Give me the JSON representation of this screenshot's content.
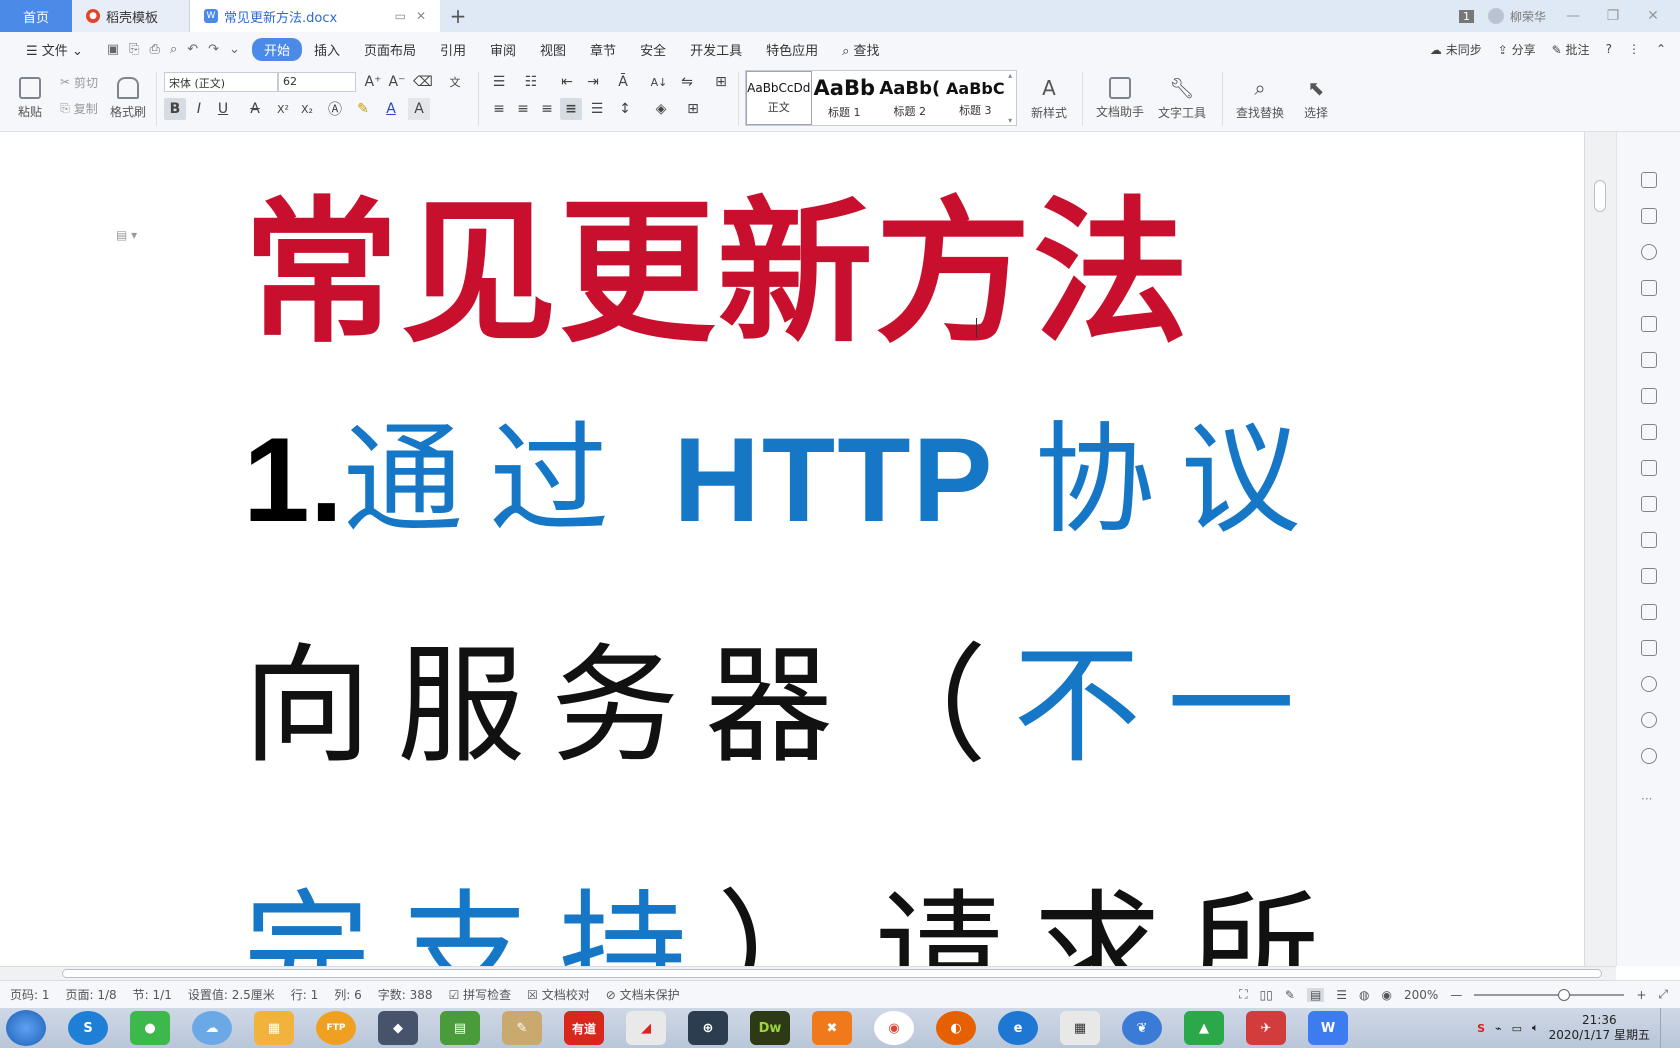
{
  "tabs": {
    "home": "首页",
    "template": "稻壳模板",
    "doc": "常见更新方法.docx",
    "badge": "1",
    "user": "柳荣华"
  },
  "menu": {
    "file": "文件",
    "items": [
      "开始",
      "插入",
      "页面布局",
      "引用",
      "审阅",
      "视图",
      "章节",
      "安全",
      "开发工具",
      "特色应用"
    ],
    "search": "查找",
    "sync": "未同步",
    "share": "分享",
    "comment": "批注"
  },
  "ribbon": {
    "paste": "粘贴",
    "cut": "剪切",
    "copy": "复制",
    "format_painter": "格式刷",
    "font_name": "宋体 (正文)",
    "font_size": "62",
    "bold": "B",
    "italic": "I",
    "underline": "U",
    "styles": [
      {
        "sample": "AaBbCcDd",
        "label": "正文"
      },
      {
        "sample": "AaBb",
        "label": "标题 1"
      },
      {
        "sample": "AaBb(",
        "label": "标题 2"
      },
      {
        "sample": "AaBbC",
        "label": "标题 3"
      }
    ],
    "new_style": "新样式",
    "doc_assistant": "文档助手",
    "text_tools": "文字工具",
    "find_replace": "查找替换",
    "select": "选择"
  },
  "document": {
    "title": "常见更新方法",
    "line2_num": "1.",
    "line2_a": "通过",
    "line2_http": "HTTP",
    "line2_b": "协议",
    "line3_a": "向服务器（",
    "line3_b": "不一",
    "line4_a": "完支持",
    "line4_b": "）请求所"
  },
  "status": {
    "page_code": "页码: 1",
    "page": "页面: 1/8",
    "section": "节: 1/1",
    "setting": "设置值: 2.5厘米",
    "row": "行: 1",
    "col": "列: 6",
    "words": "字数: 388",
    "spell": "拼写检查",
    "proof": "文档校对",
    "protect": "文档未保护",
    "zoom": "200%"
  },
  "taskbar": {
    "time": "21:36",
    "date": "2020/1/17 星期五",
    "youdao": "有道",
    "dw": "Dw",
    "ftp": "FTP"
  }
}
